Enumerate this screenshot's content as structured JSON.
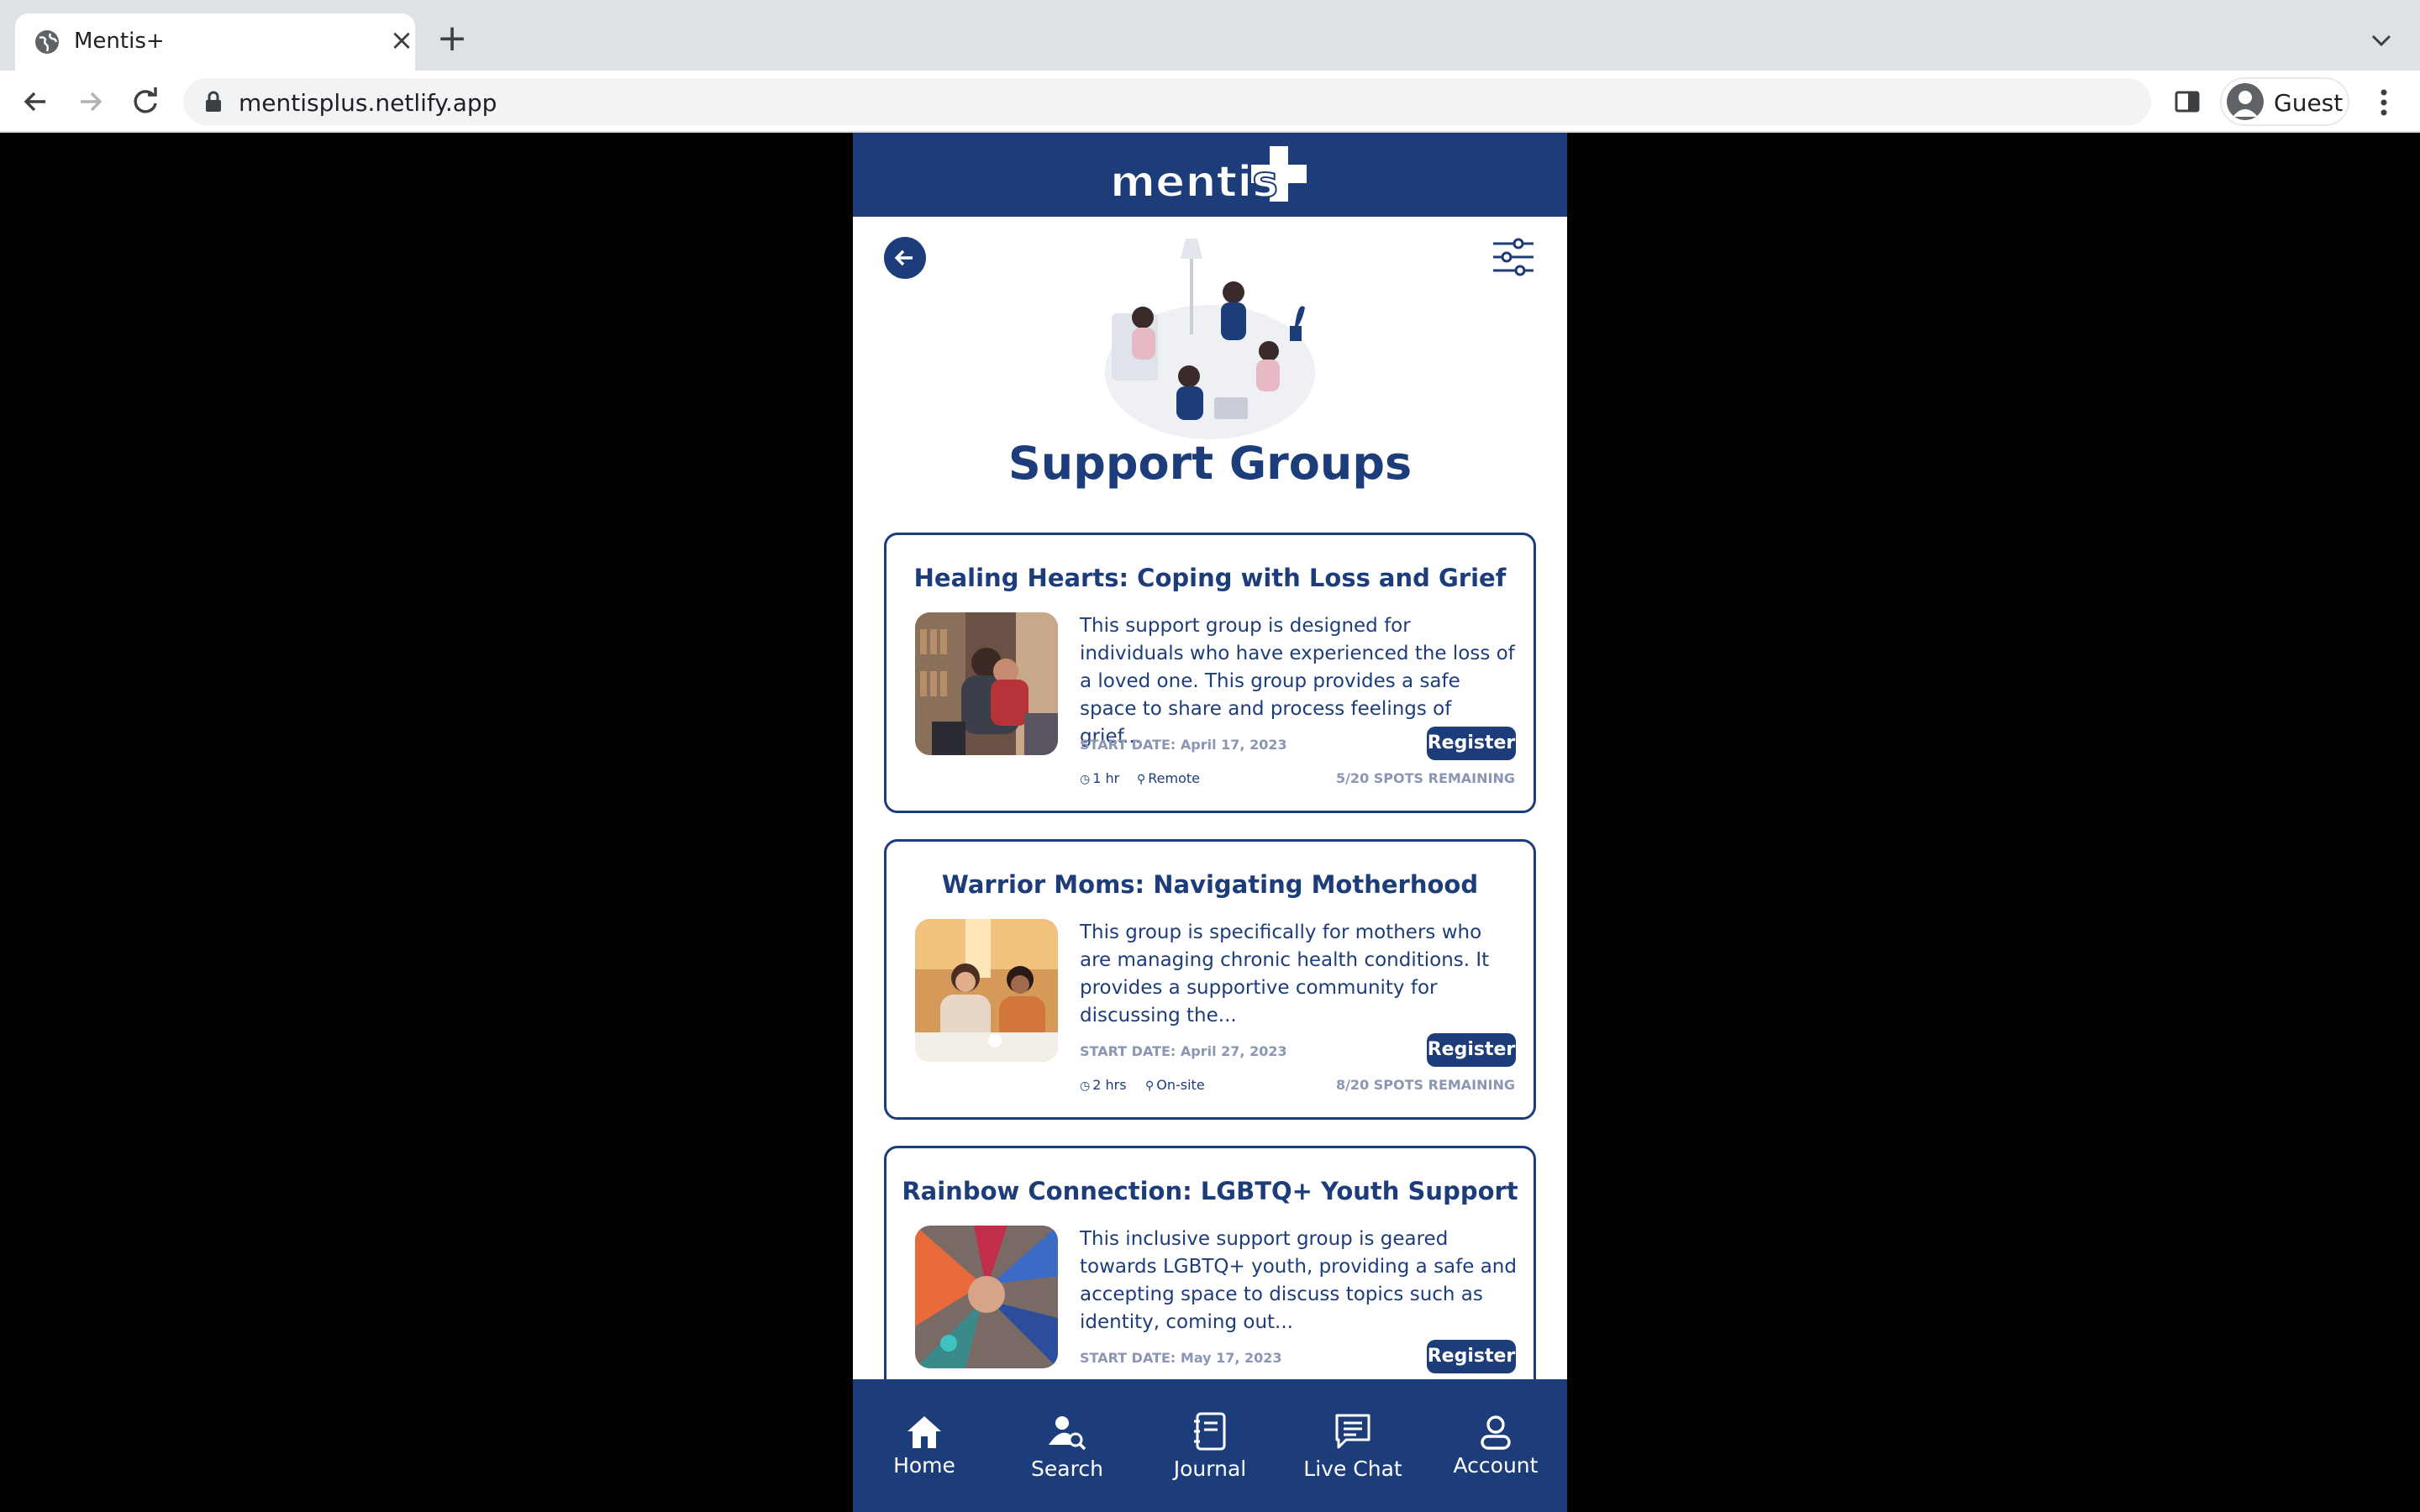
{
  "browser": {
    "tab_title": "Mentis+",
    "url": "mentisplus.netlify.app",
    "profile_label": "Guest"
  },
  "app": {
    "brand_color": "#1d3d7a",
    "logo_text": "mentis",
    "page_title": "Support Groups",
    "groups": [
      {
        "title": "Healing Hearts: Coping with Loss and Grief",
        "description": "This support group is designed for individuals who have experienced the loss of a loved one. This group provides a safe space to share and process feelings of grief...",
        "start_date": "START DATE: April 17, 2023",
        "register_label": "Register",
        "duration": "1 hr",
        "location": "Remote",
        "spots": "5/20 SPOTS REMAINING"
      },
      {
        "title": "Warrior Moms: Navigating Motherhood",
        "description": "This group is specifically for mothers who are managing chronic health conditions. It provides a supportive community for discussing the...",
        "start_date": "START DATE: April 27, 2023",
        "register_label": "Register",
        "duration": "2 hrs",
        "location": "On-site",
        "spots": "8/20 SPOTS REMAINING"
      },
      {
        "title": "Rainbow Connection: LGBTQ+ Youth Support",
        "description": "This inclusive support group is geared towards LGBTQ+ youth, providing a safe and accepting space to discuss topics such as identity, coming out...",
        "start_date": "START DATE: May 17, 2023",
        "register_label": "Register"
      }
    ],
    "nav": [
      {
        "label": "Home",
        "icon": "home-icon"
      },
      {
        "label": "Search",
        "icon": "search-person-icon"
      },
      {
        "label": "Journal",
        "icon": "journal-icon"
      },
      {
        "label": "Live Chat",
        "icon": "chat-icon"
      },
      {
        "label": "Account",
        "icon": "account-icon"
      }
    ]
  }
}
